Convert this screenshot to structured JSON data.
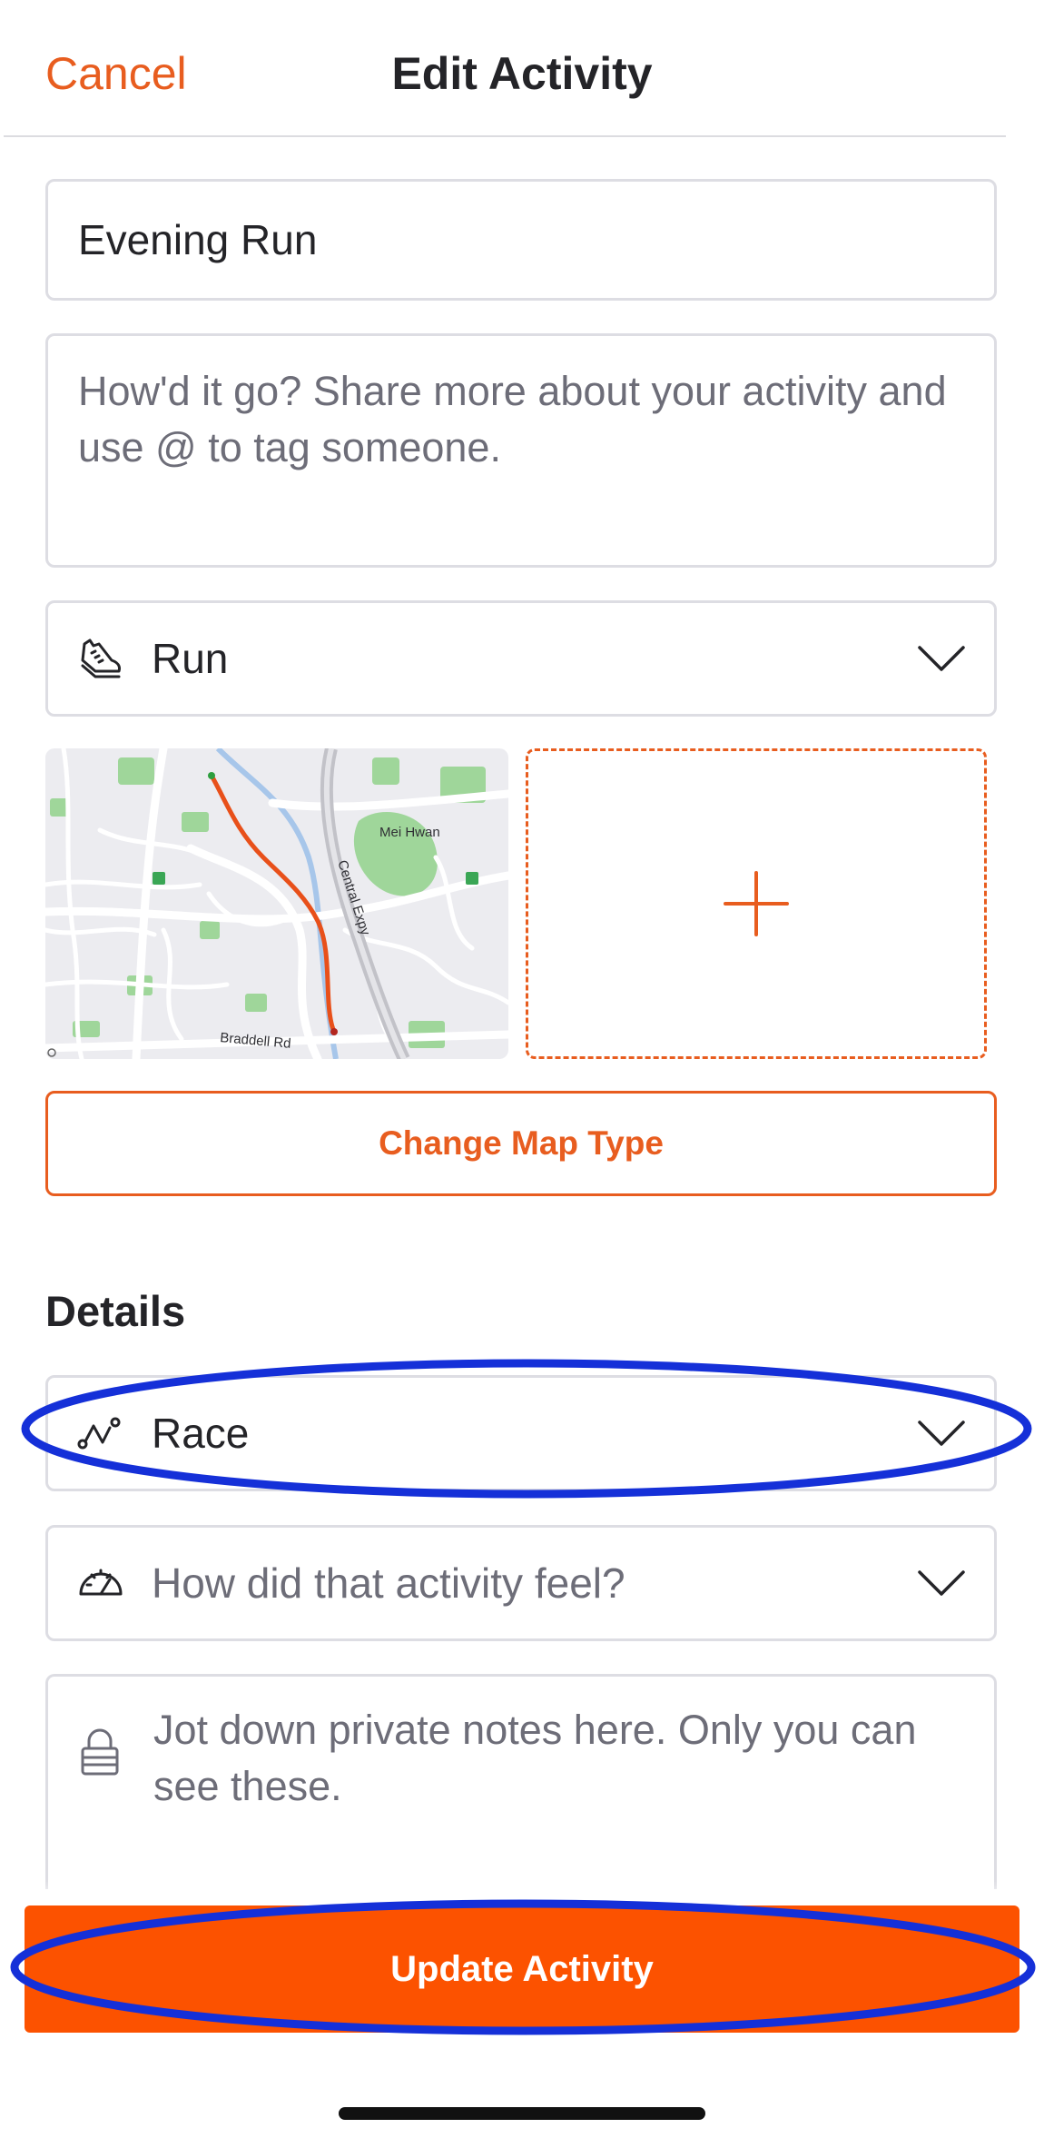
{
  "header": {
    "cancel_label": "Cancel",
    "title": "Edit Activity"
  },
  "form": {
    "activity_name": "Evening Run",
    "description_placeholder": "How'd it go? Share more about your activity and use @ to tag someone.",
    "sport_type": {
      "label": "Run",
      "icon": "running-shoe-icon"
    },
    "map": {
      "labels": [
        "Mei Hwan",
        "Central Expy",
        "Braddell Rd"
      ]
    },
    "add_media_icon": "plus-icon",
    "change_map_label": "Change Map Type",
    "details_heading": "Details",
    "workout_type": {
      "label": "Race",
      "icon": "race-route-icon"
    },
    "perceived_exertion": {
      "label": "How did that activity feel?",
      "icon": "speedometer-icon"
    },
    "private_notes_placeholder": "Jot down private notes here. Only you can see these.",
    "private_notes_icon": "lock-icon"
  },
  "footer": {
    "update_label": "Update Activity"
  },
  "colors": {
    "accent": "#fc5200",
    "accent_text": "#e85d1f",
    "annotation": "#1530d8"
  }
}
